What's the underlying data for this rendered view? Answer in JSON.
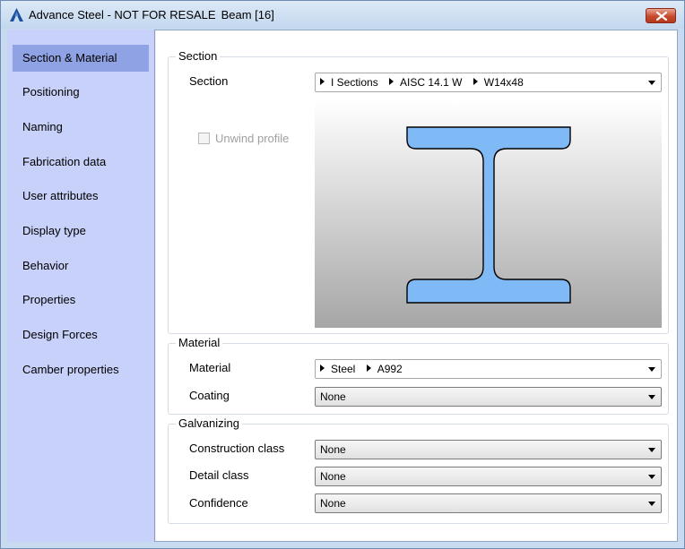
{
  "window": {
    "app_title": "Advance Steel - NOT FOR RESALE",
    "object_title": "Beam [16]"
  },
  "nav": {
    "items": [
      {
        "label": "Section & Material",
        "selected": true
      },
      {
        "label": "Positioning"
      },
      {
        "label": "Naming"
      },
      {
        "label": "Fabrication data"
      },
      {
        "label": "User attributes"
      },
      {
        "label": "Display type"
      },
      {
        "label": "Behavior"
      },
      {
        "label": "Properties"
      },
      {
        "label": "Design Forces"
      },
      {
        "label": "Camber properties"
      }
    ]
  },
  "section_group": {
    "title": "Section",
    "section_label": "Section",
    "section_path": [
      "I Sections",
      "AISC 14.1 W",
      "W14x48"
    ],
    "unwind_label": "Unwind profile",
    "unwind_checked": false,
    "unwind_enabled": false
  },
  "material_group": {
    "title": "Material",
    "material_label": "Material",
    "material_path": [
      "Steel",
      "A992"
    ],
    "coating_label": "Coating",
    "coating_value": "None"
  },
  "galvanizing_group": {
    "title": "Galvanizing",
    "construction_label": "Construction class",
    "construction_value": "None",
    "detail_label": "Detail class",
    "detail_value": "None",
    "confidence_label": "Confidence",
    "confidence_value": "None"
  },
  "colors": {
    "nav_background": "#c7d1f9",
    "nav_selected": "#8fa3e4",
    "profile_fill": "#7fbaf7",
    "close_button": "#c64a2e"
  },
  "icons": {
    "app": "advance-steel-logo-icon",
    "close": "close-icon",
    "dropdown": "chevron-down-icon",
    "breadcrumb": "triangle-right-icon"
  }
}
